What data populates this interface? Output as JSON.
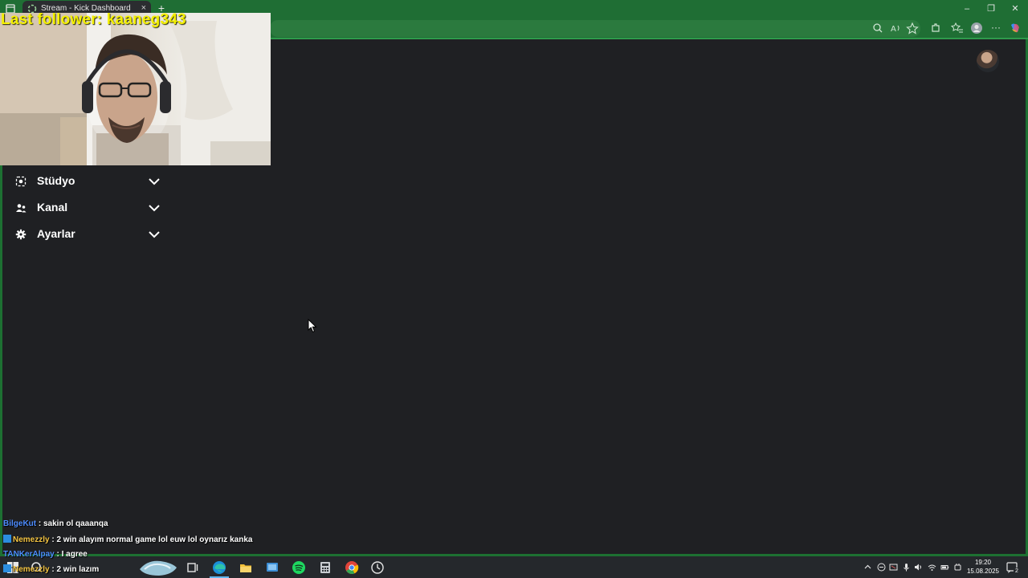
{
  "browser": {
    "tab_title": "Stream - Kick Dashboard",
    "tab_close": "×",
    "new_tab": "+",
    "window_controls": {
      "minimize": "–",
      "maximize": "❐",
      "close": "✕"
    },
    "more_menu": "···",
    "accent_color": "#1f6e34"
  },
  "overlay": {
    "follower_text": "Last follower: kaaneg343",
    "follower_color": "#f4f000"
  },
  "sidebar": {
    "items": [
      {
        "label": "Stüdyo",
        "icon": "studio-icon"
      },
      {
        "label": "Kanal",
        "icon": "channel-users-icon"
      },
      {
        "label": "Ayarlar",
        "icon": "gear-icon"
      }
    ]
  },
  "chat": {
    "messages": [
      {
        "user": "BilgeKut",
        "sep": " : ",
        "text": "sakin ol qaaanqa"
      },
      {
        "user": "Nemezzly",
        "sep": " : ",
        "text": "2 win alayım normal game lol euw lol oynarız kanka"
      },
      {
        "user": "TANKerAlpay",
        "sep": " : ",
        "text": "I agree"
      },
      {
        "user": "Nemezzly",
        "sep": " : ",
        "text": "2 win lazım"
      }
    ]
  },
  "taskbar": {
    "time": "19:20",
    "date": "15.08.2025",
    "notification_count": "2"
  }
}
